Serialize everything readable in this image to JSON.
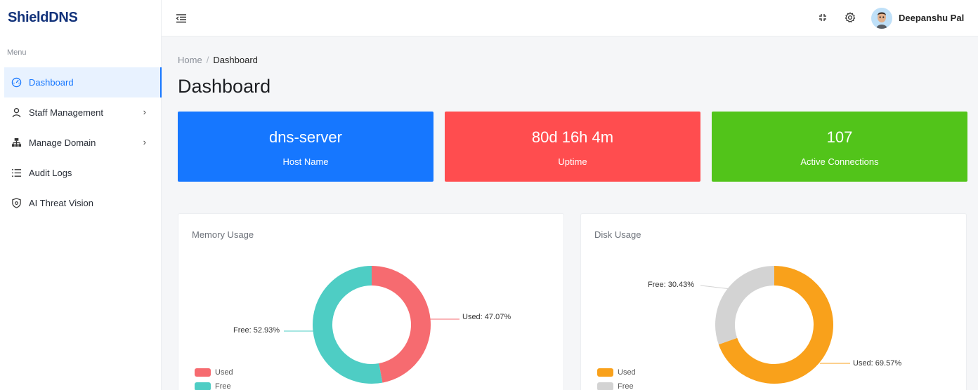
{
  "app": {
    "name": "ShieldDNS"
  },
  "sidebar": {
    "menu_title": "Menu",
    "items": [
      {
        "label": "Dashboard",
        "icon": "dashboard-icon",
        "active": true
      },
      {
        "label": "Staff Management",
        "icon": "user-icon",
        "expandable": true
      },
      {
        "label": "Manage Domain",
        "icon": "sitemap-icon",
        "expandable": true
      },
      {
        "label": "Audit Logs",
        "icon": "list-icon"
      },
      {
        "label": "AI Threat Vision",
        "icon": "shield-icon"
      }
    ]
  },
  "header": {
    "user_name": "Deepanshu Pal",
    "icons": [
      "menu-fold-icon",
      "fullscreen-icon",
      "settings-icon"
    ]
  },
  "breadcrumb": {
    "home": "Home",
    "separator": "/",
    "current": "Dashboard"
  },
  "page": {
    "title": "Dashboard"
  },
  "stats": [
    {
      "value": "dns-server",
      "label": "Host Name",
      "color": "#1677ff"
    },
    {
      "value": "80d 16h 4m",
      "label": "Uptime",
      "color": "#ff4d4f"
    },
    {
      "value": "107",
      "label": "Active Connections",
      "color": "#52c41a"
    }
  ],
  "chart_data": [
    {
      "type": "pie",
      "title": "Memory Usage",
      "categories": [
        "Used",
        "Free"
      ],
      "values": [
        47.07,
        52.93
      ],
      "data_labels": [
        "Used: 47.07%",
        "Free: 52.93%"
      ],
      "colors": [
        "#f66b70",
        "#4ecdc4"
      ],
      "legend": "bottom-left"
    },
    {
      "type": "pie",
      "title": "Disk Usage",
      "categories": [
        "Used",
        "Free"
      ],
      "values": [
        69.57,
        30.43
      ],
      "data_labels": [
        "Used: 69.57%",
        "Free: 30.43%"
      ],
      "colors": [
        "#f9a11b",
        "#d3d3d3"
      ],
      "legend": "bottom-left"
    }
  ]
}
